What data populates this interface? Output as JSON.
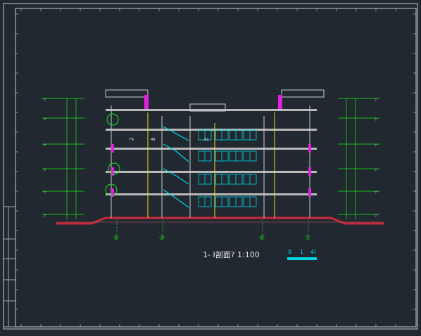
{
  "drawing": {
    "title": "1- I剖面? 1:100",
    "scale_bar_labels": [
      "0",
      "1",
      "4l"
    ],
    "axis_labels": [
      "①",
      "③",
      "⑤",
      "⑦"
    ],
    "room_tags": [
      "F6",
      "4B",
      "A1"
    ]
  },
  "colors": {
    "background": "#212830",
    "frame": "#c9ccd1",
    "slab": "#b9b9b9",
    "ground": "#c8283c",
    "dimension": "#19e619",
    "cyan": "#00d8e8",
    "magenta": "#e020e0",
    "yellow": "#e8e020",
    "text": "#e8e8e8"
  }
}
